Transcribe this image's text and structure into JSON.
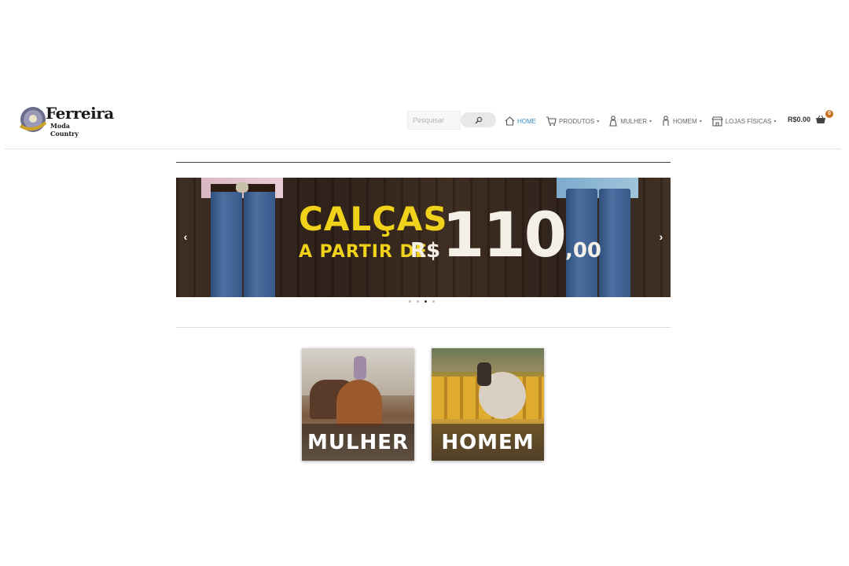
{
  "brand": {
    "name": "Ferreira",
    "subtitle": "Moda Country"
  },
  "search": {
    "placeholder": "Pesquisar"
  },
  "nav": {
    "items": [
      {
        "label": "HOME",
        "active": true,
        "icon": "home-icon",
        "dropdown": false
      },
      {
        "label": "PRODUTOS",
        "active": false,
        "icon": "cart-produtos-icon",
        "dropdown": true
      },
      {
        "label": "MULHER",
        "active": false,
        "icon": "woman-icon",
        "dropdown": true
      },
      {
        "label": "HOMEM",
        "active": false,
        "icon": "man-icon",
        "dropdown": true
      },
      {
        "label": "LOJAS FÍSICAS",
        "active": false,
        "icon": "store-icon",
        "dropdown": true
      }
    ]
  },
  "cart": {
    "total": "R$0.00",
    "count": "0"
  },
  "slider": {
    "headline_line1": "CALÇAS",
    "headline_line2": "A PARTIR DE",
    "currency": "R$",
    "price_big": "110",
    "price_cents": ",00",
    "prev_label": "‹",
    "next_label": "›",
    "slides": 4,
    "active_slide": 3
  },
  "categories": [
    {
      "label": "MULHER"
    },
    {
      "label": "HOMEM"
    }
  ],
  "colors": {
    "accent_active": "#3b8fc4",
    "cart_badge": "#c7711f",
    "headline_yellow": "#f1d21a"
  }
}
